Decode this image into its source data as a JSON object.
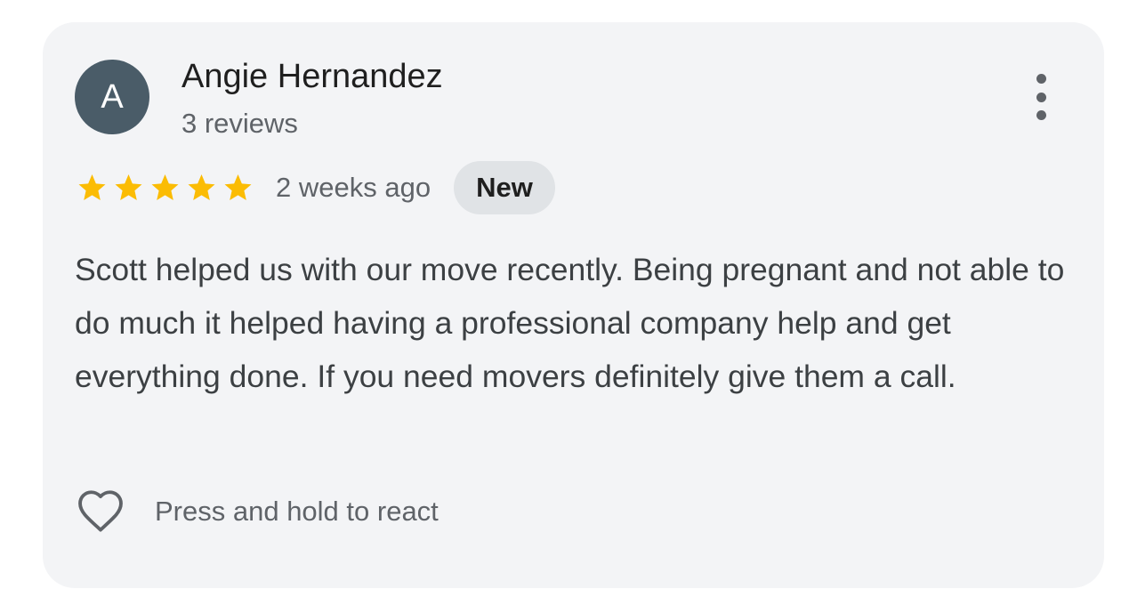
{
  "review": {
    "author": {
      "initial": "A",
      "name": "Angie Hernandez",
      "reviews_count": "3 reviews",
      "avatar_color": "#4a5c68"
    },
    "rating": 5,
    "rating_max": 5,
    "star_color": "#fbbc04",
    "time": "2 weeks ago",
    "badge": "New",
    "text": "Scott helped us with our move recently. Being pregnant and not able to do much it helped having a professional company help and get everything done. If you need movers definitely give them a call.",
    "more_icon": "more-vert-icon"
  },
  "reaction": {
    "icon": "heart-outline-icon",
    "label": "Press and hold to react"
  }
}
